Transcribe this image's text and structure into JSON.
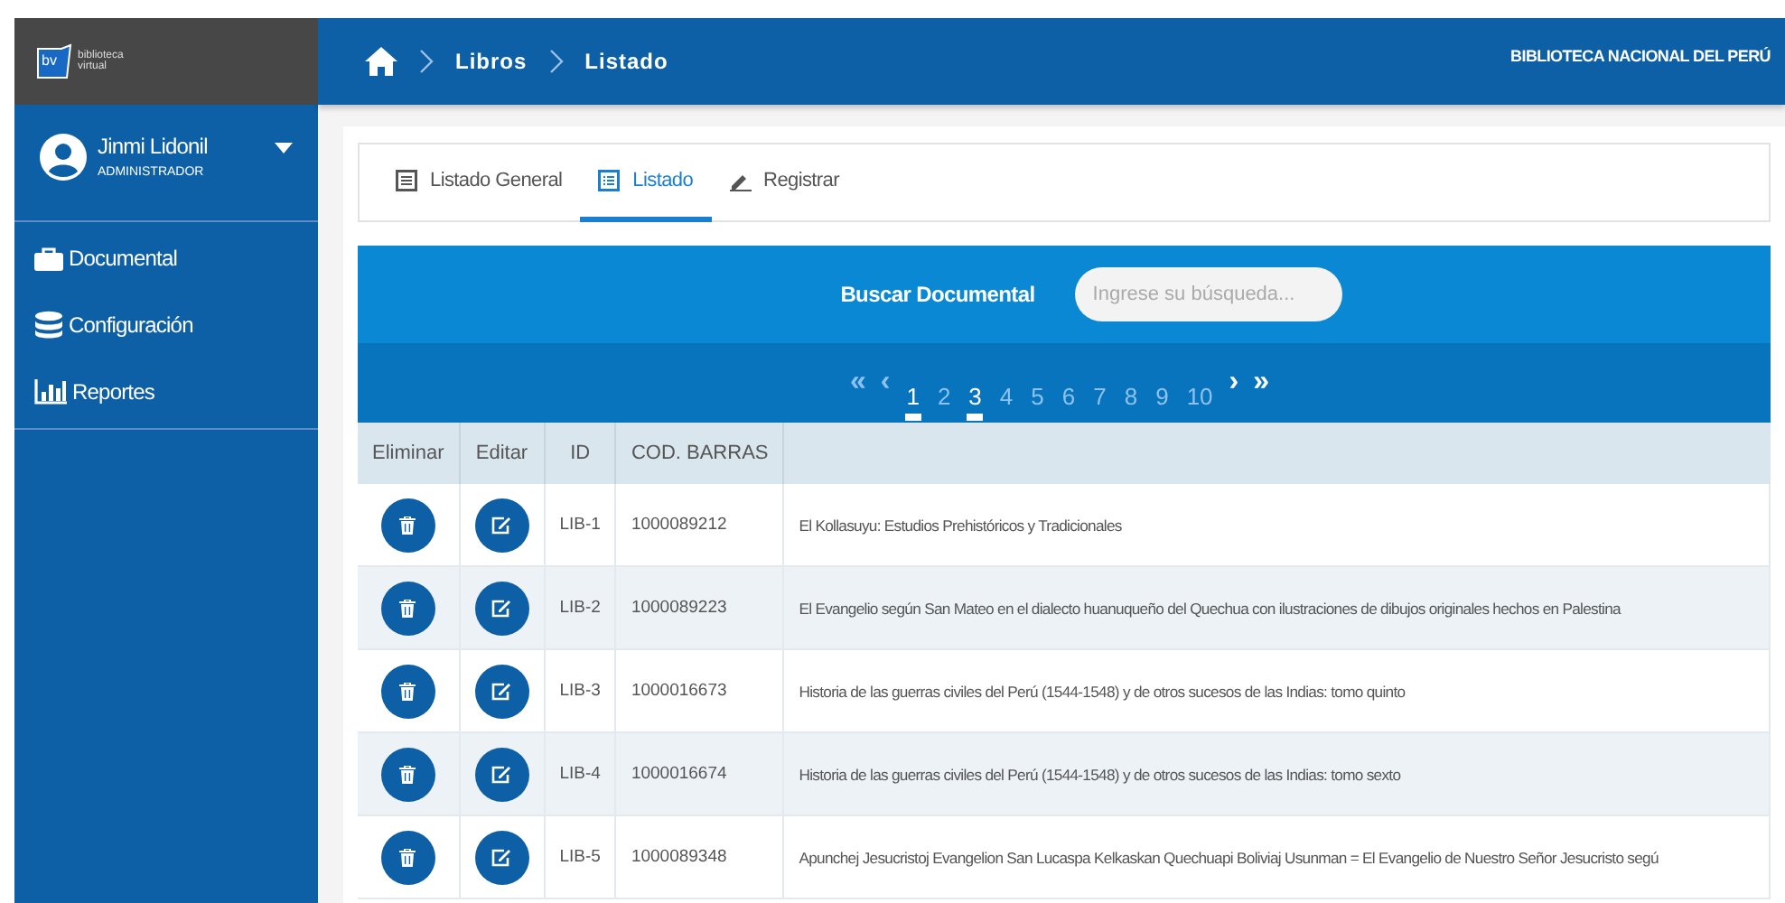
{
  "logo": {
    "mark": "bv",
    "text": [
      "biblioteca",
      "virtual"
    ]
  },
  "user": {
    "name": "Jinmi Lidonil",
    "role": "ADMINISTRADOR",
    "expanded": false
  },
  "sidebar": {
    "items": [
      {
        "label": "Documental",
        "kind": "briefcase"
      },
      {
        "label": "Configuración",
        "kind": "database"
      },
      {
        "label": "Reportes",
        "kind": "chart"
      }
    ]
  },
  "breadcrumb": [
    "Libros",
    "Listado"
  ],
  "header_title": "BIBLIOTECA NACIONAL DEL PERÚ",
  "tabs": [
    {
      "label": "Listado General",
      "kind": "list",
      "selected": false
    },
    {
      "label": "Listado",
      "kind": "table",
      "selected": true
    },
    {
      "label": "Registrar",
      "kind": "pen",
      "selected": false
    }
  ],
  "search": {
    "label": "Buscar Documental",
    "placeholder": "Ingrese su búsqueda..."
  },
  "pagination": {
    "first": "«",
    "prev": "‹",
    "next": "›",
    "last": "»",
    "pages": [
      {
        "label": "1",
        "selected": true
      },
      {
        "label": "2",
        "selected": false
      },
      {
        "label": "3",
        "selected": true
      },
      {
        "label": "4",
        "selected": false
      },
      {
        "label": "5",
        "selected": false
      },
      {
        "label": "6",
        "selected": false
      },
      {
        "label": "7",
        "selected": false
      },
      {
        "label": "8",
        "selected": false
      },
      {
        "label": "9",
        "selected": false
      },
      {
        "label": "10",
        "selected": false
      }
    ]
  },
  "table": {
    "columns": [
      "Eliminar",
      "Editar",
      "ID",
      "COD. BARRAS"
    ],
    "rows": [
      {
        "id": "LIB-1",
        "code": "1000089212",
        "title": "El Kollasuyu: Estudios Prehistóricos y Tradicionales"
      },
      {
        "id": "LIB-2",
        "code": "1000089223",
        "title": "El Evangelio según San Mateo en el dialecto huanuqueño del Quechua con ilustraciones de dibujos originales hechos en Palestina"
      },
      {
        "id": "LIB-3",
        "code": "1000016673",
        "title": "Historia de las guerras civiles del Perú (1544-1548) y de otros sucesos de las Indias: tomo quinto"
      },
      {
        "id": "LIB-4",
        "code": "1000016674",
        "title": "Historia de las guerras civiles del Perú (1544-1548) y de otros sucesos de las Indias: tomo sexto"
      },
      {
        "id": "LIB-5",
        "code": "1000089348",
        "title": "Apunchej Jesucristoj Evangelion San Lucaspa Kelkaskan Quechuapi Boliviaj Usunman = El Evangelio de Nuestro Señor Jesucristo segú"
      }
    ]
  }
}
